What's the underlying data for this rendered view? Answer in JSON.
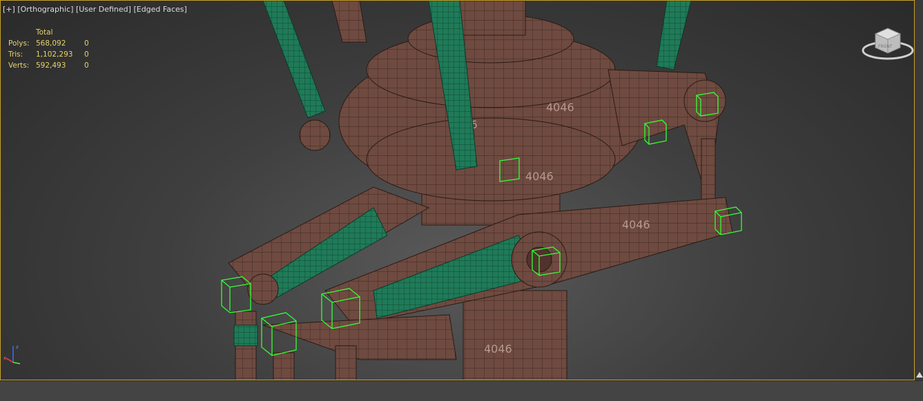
{
  "viewport": {
    "label_parts": [
      "[+]",
      "[Orthographic]",
      "[User Defined]",
      "[Edged Faces]"
    ],
    "stats": {
      "header": "Total",
      "rows": [
        {
          "label": "Polys:",
          "total": "568,092",
          "selected": "0"
        },
        {
          "label": "Tris:",
          "total": "1,102,293",
          "selected": "0"
        },
        {
          "label": "Verts:",
          "total": "592,493",
          "selected": "0"
        }
      ]
    },
    "viewcube": {
      "face_label": "FRONT",
      "icon": "viewcube-icon"
    },
    "axis_tripod": {
      "icon": "axis-tripod-icon"
    },
    "texture_text": "4046",
    "colors": {
      "body": "#6e4a40",
      "accent": "#2aa071",
      "selection": "#33ff33",
      "stats_text": "#e7d36b",
      "border": "#c9a227"
    }
  }
}
